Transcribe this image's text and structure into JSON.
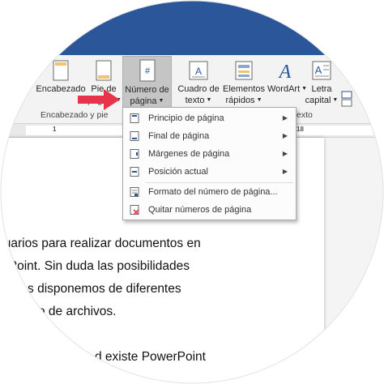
{
  "ribbon": {
    "header": {
      "label_line1": "Encabezado"
    },
    "footer": {
      "label_line1": "Pie de",
      "label_line2": "página"
    },
    "page_number": {
      "label_line1": "Número de",
      "label_line2": "página"
    },
    "textbox": {
      "label_line1": "Cuadro de",
      "label_line2": "texto"
    },
    "quick_parts": {
      "label_line1": "Elementos",
      "label_line2": "rápidos"
    },
    "wordart": {
      "label_line1": "WordArt"
    },
    "dropcap": {
      "label_line1": "Letra",
      "label_line2": "capital"
    },
    "group_header_footer": "Encabezado y pie",
    "group_text": "exto"
  },
  "ruler": {
    "marks": [
      "1",
      "18"
    ]
  },
  "menu": {
    "items": [
      {
        "label": "Principio de página",
        "has_submenu": true,
        "icon": "page-top-icon"
      },
      {
        "label": "Final de página",
        "has_submenu": true,
        "icon": "page-bottom-icon"
      },
      {
        "label": "Márgenes de página",
        "has_submenu": true,
        "icon": "page-margins-icon"
      },
      {
        "label": "Posición actual",
        "has_submenu": true,
        "icon": "current-position-icon"
      },
      {
        "label": "Formato del número de página...",
        "has_submenu": false,
        "icon": "format-number-icon"
      },
      {
        "label": "Quitar números de página",
        "has_submenu": false,
        "icon": "remove-numbers-icon"
      }
    ]
  },
  "document": {
    "lines": [
      "suarios para realizar documentos en",
      "erPoint. Sin duda las posibilidades",
      "e ellas disponemos de diferentes",
      "este tipo de archivos.",
      "d existe PowerPoint"
    ]
  },
  "colors": {
    "titlebar": "#2b579a",
    "pointer_arrow": "#e8344a",
    "wordart_blue": "#2b579a"
  }
}
